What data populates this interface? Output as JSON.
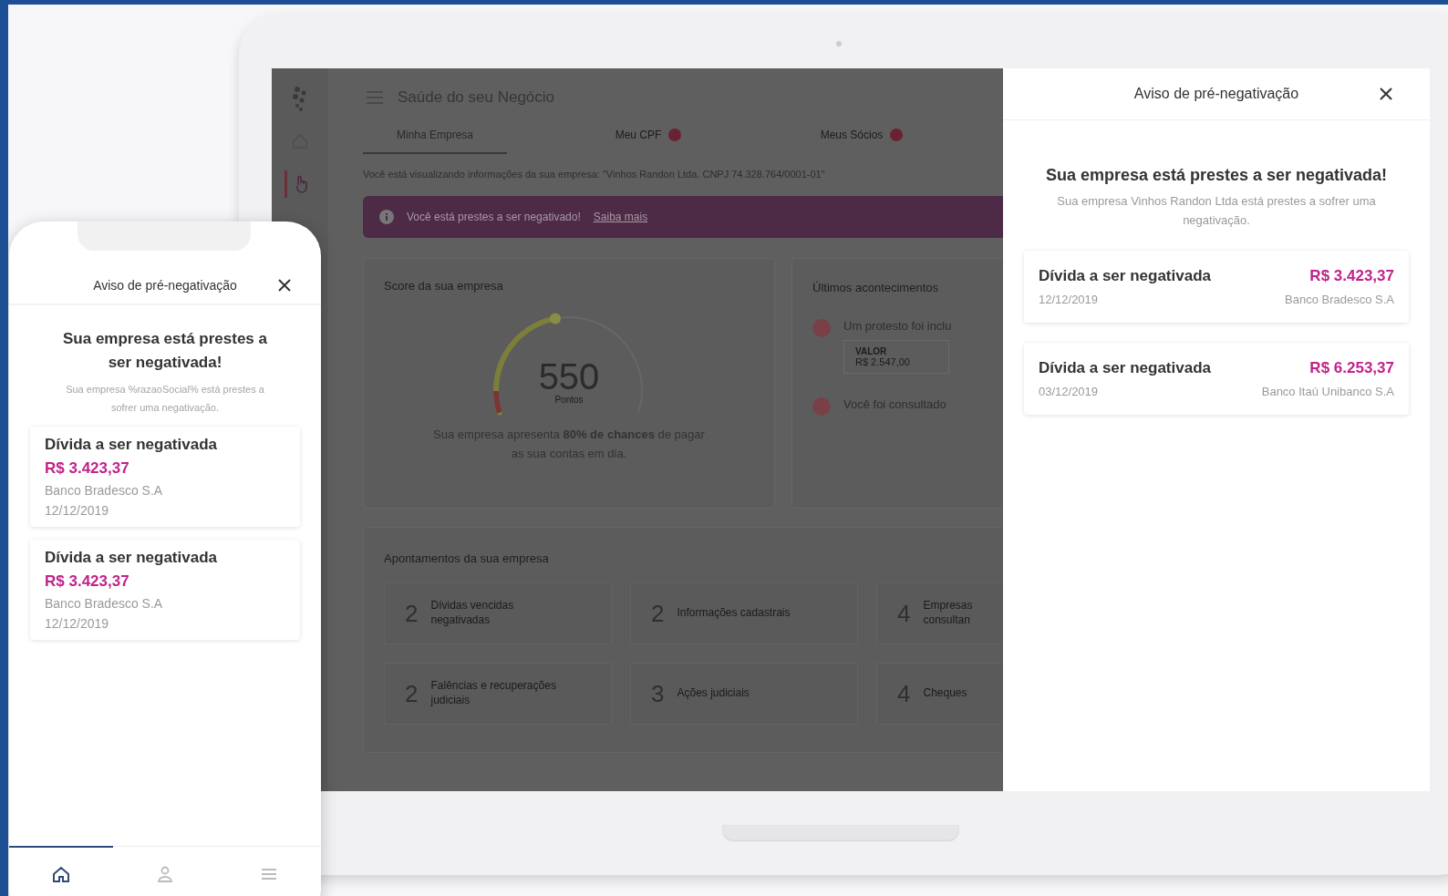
{
  "laptop": {
    "sidebar": {
      "items": [
        {
          "selected": false
        },
        {
          "selected": true
        }
      ]
    },
    "header": {
      "title": "Saúde do seu Negócio"
    },
    "tabs": [
      {
        "label": "Minha Empresa",
        "selected": true,
        "alert": false
      },
      {
        "label": "Meu CPF",
        "selected": false,
        "alert": true
      },
      {
        "label": "Meus Sócios",
        "selected": false,
        "alert": true
      }
    ],
    "notice": "Você está visualizando informações da sua empresa: \"Vinhos Randon Ltda. CNPJ 74.328.764/0001-01\"",
    "banner": {
      "text": "Você está prestes a ser negativado!",
      "link": "Saiba mais"
    },
    "score_card": {
      "title": "Score da sua empresa",
      "score": "550",
      "unit": "Pontos",
      "level": 0.45,
      "message": "Sua empresa apresenta **80% de chances** de pagar as sua contas em dia."
    },
    "events_card": {
      "title": "Últimos acontecimentos",
      "events": [
        {
          "title": "Um protesto foi inclu",
          "value_label": "VALOR",
          "value": "R$ 2.547,00"
        },
        {
          "title": "Você foi consultado"
        }
      ]
    },
    "appointments": {
      "title": "Apontamentos da sua empresa",
      "tiles": [
        {
          "count": "2",
          "label": "Dívidas vencidas negativadas"
        },
        {
          "count": "2",
          "label": "Informações cadastrais"
        },
        {
          "count": "4",
          "label": "Empresas consultan"
        },
        {
          "count": "2",
          "label": "Falências e recuperações judiciais"
        },
        {
          "count": "3",
          "label": "Ações judiciais"
        },
        {
          "count": "4",
          "label": "Cheques"
        }
      ]
    },
    "drawer": {
      "title": "Aviso de pré-negativação",
      "heading": "Sua empresa está prestes a ser negativada!",
      "text": "Sua empresa Vinhos Randon Ltda está prestes a sofrer uma negativação.",
      "debts": [
        {
          "title": "Dívida a ser negativada",
          "amount": "R$ 3.423,37",
          "date": "12/12/2019",
          "bank": "Banco Bradesco S.A"
        },
        {
          "title": "Dívida a ser negativada",
          "amount": "R$ 6.253,37",
          "date": "03/12/2019",
          "bank": "Banco Itaú Unibanco S.A"
        }
      ]
    }
  },
  "phone": {
    "title": "Aviso de pré-negativação",
    "heading": "Sua empresa está prestes a ser negativada!",
    "text": "Sua empresa %razaoSocial% está prestes a sofrer uma negativação.",
    "debts": [
      {
        "title": "Dívida a ser negativada",
        "amount": "R$ 3.423,37",
        "bank": "Banco Bradesco S.A",
        "date": "12/12/2019"
      },
      {
        "title": "Dívida a ser negativada",
        "amount": "R$ 3.423,37",
        "bank": "Banco Bradesco S.A",
        "date": "12/12/2019"
      }
    ],
    "nav": [
      {
        "selected": true
      },
      {
        "selected": false
      },
      {
        "selected": false
      }
    ]
  }
}
